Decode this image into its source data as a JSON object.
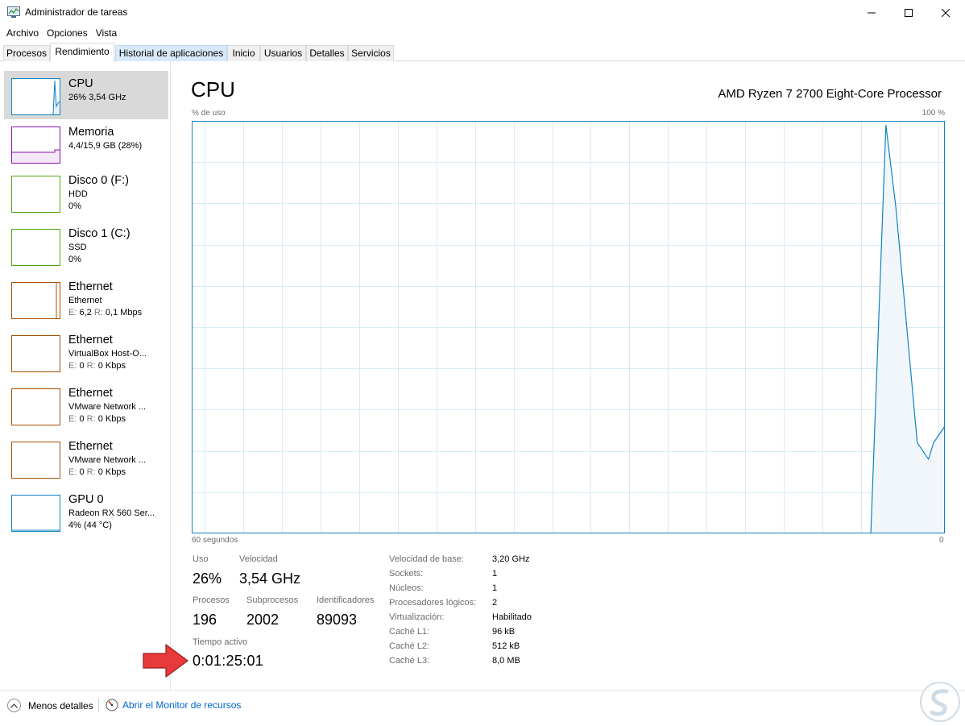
{
  "window": {
    "title": "Administrador de tareas",
    "controls": [
      "minimize",
      "maximize",
      "close"
    ]
  },
  "menu": [
    "Archivo",
    "Opciones",
    "Vista"
  ],
  "tabs": [
    {
      "label": "Procesos"
    },
    {
      "label": "Rendimiento",
      "active": true
    },
    {
      "label": "Historial de aplicaciones"
    },
    {
      "label": "Inicio"
    },
    {
      "label": "Usuarios"
    },
    {
      "label": "Detalles"
    },
    {
      "label": "Servicios"
    }
  ],
  "sidebar": {
    "items": [
      {
        "title": "CPU",
        "line1": "26% 3,54 GHz",
        "line2": "",
        "color": "#1183c3",
        "selected": true
      },
      {
        "title": "Memoria",
        "line1": "4,4/15,9 GB (28%)",
        "line2": "",
        "color": "#8b12ae"
      },
      {
        "title": "Disco 0 (F:)",
        "line1": "HDD",
        "line2": "0%",
        "color": "#4da60c"
      },
      {
        "title": "Disco 1 (C:)",
        "line1": "SSD",
        "line2": "0%",
        "color": "#4da60c"
      },
      {
        "title": "Ethernet",
        "line1": "Ethernet",
        "line2_e": "E:",
        "line2_ev": "6,2",
        "line2_r": "R:",
        "line2_rv": "0,1 Mbps",
        "color": "#a74f01"
      },
      {
        "title": "Ethernet",
        "line1": "VirtualBox Host-O...",
        "line2_e": "E:",
        "line2_ev": "0",
        "line2_r": "R:",
        "line2_rv": "0 Kbps",
        "color": "#a74f01"
      },
      {
        "title": "Ethernet",
        "line1": "VMware Network ...",
        "line2_e": "E:",
        "line2_ev": "0",
        "line2_r": "R:",
        "line2_rv": "0 Kbps",
        "color": "#a74f01"
      },
      {
        "title": "Ethernet",
        "line1": "VMware Network ...",
        "line2_e": "E:",
        "line2_ev": "0",
        "line2_r": "R:",
        "line2_rv": "0 Kbps",
        "color": "#a74f01"
      },
      {
        "title": "GPU 0",
        "line1": "Radeon RX 560 Ser...",
        "line2": "4% (44 °C)",
        "color": "#1183c3"
      }
    ]
  },
  "main": {
    "title": "CPU",
    "processor": "AMD Ryzen 7 2700 Eight-Core Processor",
    "y_label": "% de uso",
    "y_max_label": "100 %",
    "x_left_label": "60 segundos",
    "x_right_label": "0",
    "stats": {
      "uso_label": "Uso",
      "uso": "26%",
      "velocidad_label": "Velocidad",
      "velocidad": "3,54 GHz",
      "procesos_label": "Procesos",
      "procesos": "196",
      "subprocesos_label": "Subprocesos",
      "subprocesos": "2002",
      "identificadores_label": "Identificadores",
      "identificadores": "89093",
      "tiempo_label": "Tiempo activo",
      "tiempo": "0:01:25:01"
    },
    "specs": [
      {
        "label": "Velocidad de base:",
        "value": "3,20 GHz"
      },
      {
        "label": "Sockets:",
        "value": "1"
      },
      {
        "label": "Núcleos:",
        "value": "1"
      },
      {
        "label": "Procesadores lógicos:",
        "value": "2"
      },
      {
        "label": "Virtualización:",
        "value": "Habilitado"
      },
      {
        "label": "Caché L1:",
        "value": "96 kB"
      },
      {
        "label": "Caché L2:",
        "value": "512 kB"
      },
      {
        "label": "Caché L3:",
        "value": "8,0 MB"
      }
    ]
  },
  "chart_data": {
    "type": "area",
    "x_unit": "seconds ago",
    "y_unit": "% de uso",
    "ylim": [
      0,
      100
    ],
    "xlim": [
      60,
      0
    ],
    "x": [
      60,
      5.9,
      4.7,
      3.9,
      2.2,
      1.3,
      0.9,
      0
    ],
    "values": [
      0,
      0,
      99,
      79,
      22,
      18,
      22,
      26
    ],
    "color": "#1183c3"
  },
  "bottom": {
    "less_details": "Menos detalles",
    "monitor_link": "Abrir el Monitor de recursos"
  },
  "colors": {
    "cpu": "#1183c3",
    "memory": "#8b12ae",
    "disk": "#4da60c",
    "ethernet": "#a74f01",
    "link": "#0066cc",
    "arrow": "#e8393b"
  }
}
